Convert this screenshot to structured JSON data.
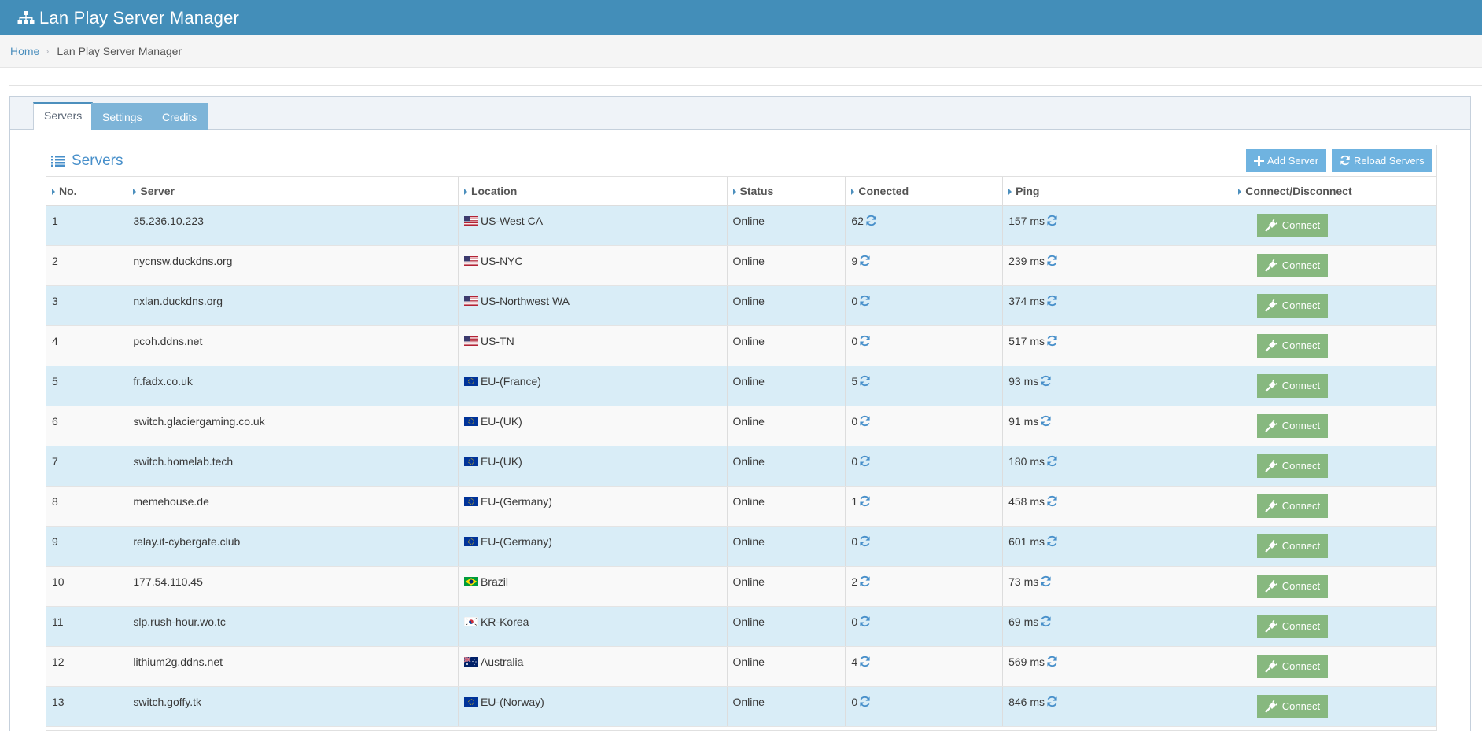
{
  "app": {
    "title": "Lan Play Server Manager",
    "logo_icon": "sitemap-icon"
  },
  "breadcrumb": {
    "home": "Home",
    "current": "Lan Play Server Manager"
  },
  "tabs": [
    {
      "label": "Servers",
      "active": true
    },
    {
      "label": "Settings",
      "active": false
    },
    {
      "label": "Credits",
      "active": false
    }
  ],
  "widget": {
    "title": "Servers",
    "icon": "list-icon",
    "add_button": "Add Server",
    "reload_button": "Reload Servers"
  },
  "columns": [
    "No.",
    "Server",
    "Location",
    "Status",
    "Conected",
    "Ping",
    "Connect/Disconnect"
  ],
  "connect_label": "Connect",
  "rows": [
    {
      "no": "1",
      "server": "35.236.10.223",
      "flag": "us",
      "location": "US-West CA",
      "status": "Online",
      "connected": "62",
      "ping": "157 ms"
    },
    {
      "no": "2",
      "server": "nycnsw.duckdns.org",
      "flag": "us",
      "location": "US-NYC",
      "status": "Online",
      "connected": "9",
      "ping": "239 ms"
    },
    {
      "no": "3",
      "server": "nxlan.duckdns.org",
      "flag": "us",
      "location": "US-Northwest WA",
      "status": "Online",
      "connected": "0",
      "ping": "374 ms"
    },
    {
      "no": "4",
      "server": "pcoh.ddns.net",
      "flag": "us",
      "location": "US-TN",
      "status": "Online",
      "connected": "0",
      "ping": "517 ms"
    },
    {
      "no": "5",
      "server": "fr.fadx.co.uk",
      "flag": "eu",
      "location": "EU-(France)",
      "status": "Online",
      "connected": "5",
      "ping": "93 ms"
    },
    {
      "no": "6",
      "server": "switch.glaciergaming.co.uk",
      "flag": "eu",
      "location": "EU-(UK)",
      "status": "Online",
      "connected": "0",
      "ping": "91 ms"
    },
    {
      "no": "7",
      "server": "switch.homelab.tech",
      "flag": "eu",
      "location": "EU-(UK)",
      "status": "Online",
      "connected": "0",
      "ping": "180 ms"
    },
    {
      "no": "8",
      "server": "memehouse.de",
      "flag": "eu",
      "location": "EU-(Germany)",
      "status": "Online",
      "connected": "1",
      "ping": "458 ms"
    },
    {
      "no": "9",
      "server": "relay.it-cybergate.club",
      "flag": "eu",
      "location": "EU-(Germany)",
      "status": "Online",
      "connected": "0",
      "ping": "601 ms"
    },
    {
      "no": "10",
      "server": "177.54.110.45",
      "flag": "br",
      "location": "Brazil",
      "status": "Online",
      "connected": "2",
      "ping": "73 ms"
    },
    {
      "no": "11",
      "server": "slp.rush-hour.wo.tc",
      "flag": "kr",
      "location": "KR-Korea",
      "status": "Online",
      "connected": "0",
      "ping": "69 ms"
    },
    {
      "no": "12",
      "server": "lithium2g.ddns.net",
      "flag": "au",
      "location": "Australia",
      "status": "Online",
      "connected": "4",
      "ping": "569 ms"
    },
    {
      "no": "13",
      "server": "switch.goffy.tk",
      "flag": "eu",
      "location": "EU-(Norway)",
      "status": "Online",
      "connected": "0",
      "ping": "846 ms"
    }
  ]
}
